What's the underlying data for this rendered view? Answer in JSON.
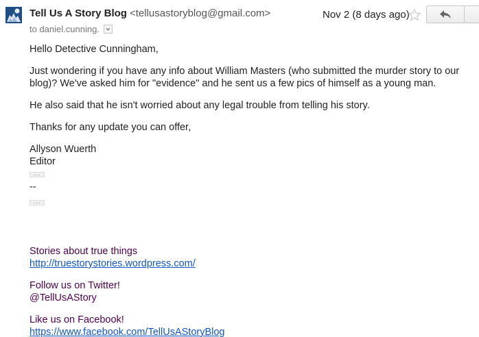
{
  "header": {
    "sender_name": "Tell Us A Story Blog",
    "sender_email": "<tellusastoryblog@gmail.com>",
    "to": "to daniel.cunning.",
    "date": "Nov 2 (8 days ago)",
    "icons": {
      "avatar": "blog-avatar",
      "details": "chevron-down-icon",
      "star": "star-icon",
      "reply": "reply-arrow-icon"
    }
  },
  "message": {
    "greeting": "Hello Detective Cunningham,",
    "paragraph1": "Just wondering if you have any info about William Masters (who submitted the murder story to our blog)? We've asked him for \"evidence\"  and he sent us a few pics of himself as a young man.",
    "paragraph2": "He also said that he isn't worried about any legal trouble from telling his story.",
    "paragraph3": "Thanks  for any update you can offer,",
    "signature_name": "Allyson Wuerth",
    "signature_title": "Editor",
    "separator": "--",
    "trimmed_content_label": "..."
  },
  "signature": {
    "stories_label": "Stories about true things",
    "stories_url": "http://truestorystories.wordpress.com/",
    "twitter_label": "Follow us on Twitter!",
    "twitter_handle": "@TellUsAStory",
    "facebook_label": "Like us on Facebook!",
    "facebook_url": "https://www.facebook.com/TellUsAStoryBlog"
  },
  "colors": {
    "signature_text": "#500050",
    "link": "#1155cc",
    "avatar_bg": "#1e4e86"
  }
}
